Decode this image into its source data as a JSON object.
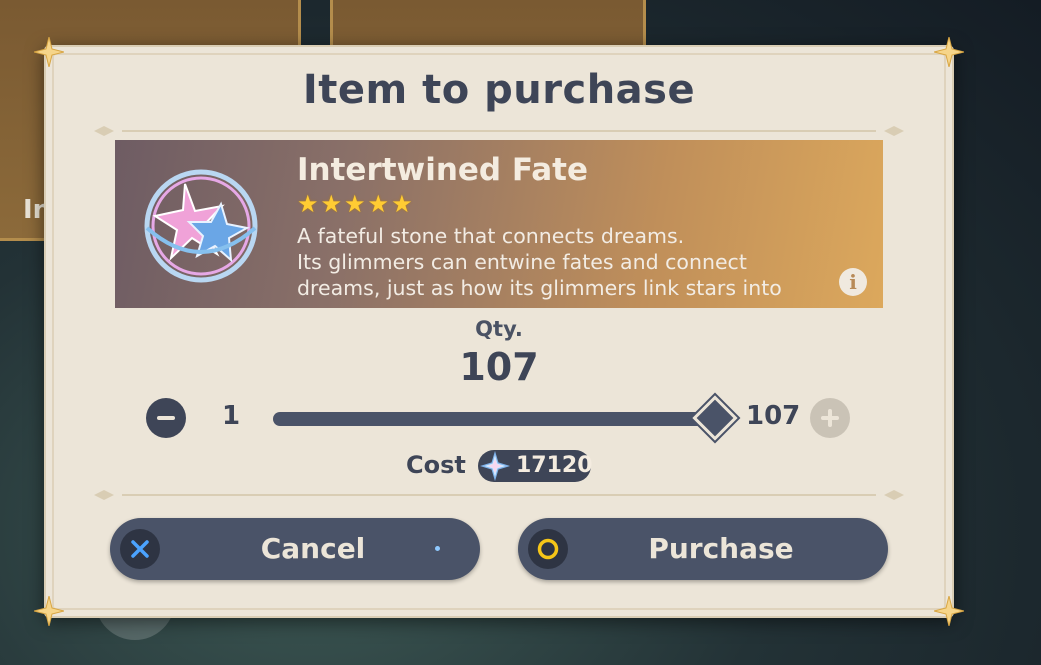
{
  "background": {
    "card_label": "In"
  },
  "dialog": {
    "title": "Item to purchase"
  },
  "item": {
    "name": "Intertwined Fate",
    "rarity_stars": 5,
    "description": [
      "A fateful stone that connects dreams.",
      "Its glimmers can entwine fates and connect",
      "dreams, just as how its glimmers link stars into"
    ],
    "info_icon": "info-icon"
  },
  "quantity": {
    "label": "Qty.",
    "value": "107",
    "min": "1",
    "max": "107",
    "slider_fraction": 1.0
  },
  "cost": {
    "label": "Cost",
    "currency_icon": "primogem-icon",
    "amount": "17120"
  },
  "buttons": {
    "cancel_label": "Cancel",
    "cancel_icon": "x-button-icon",
    "purchase_label": "Purchase",
    "purchase_icon": "circle-button-icon"
  },
  "colors": {
    "panel": "#ece5d8",
    "text_dark": "#3e4557",
    "button": "#4a5368",
    "star": "#ffcc33",
    "accent_blue": "#4ba3ff",
    "accent_gold": "#f5c518"
  }
}
